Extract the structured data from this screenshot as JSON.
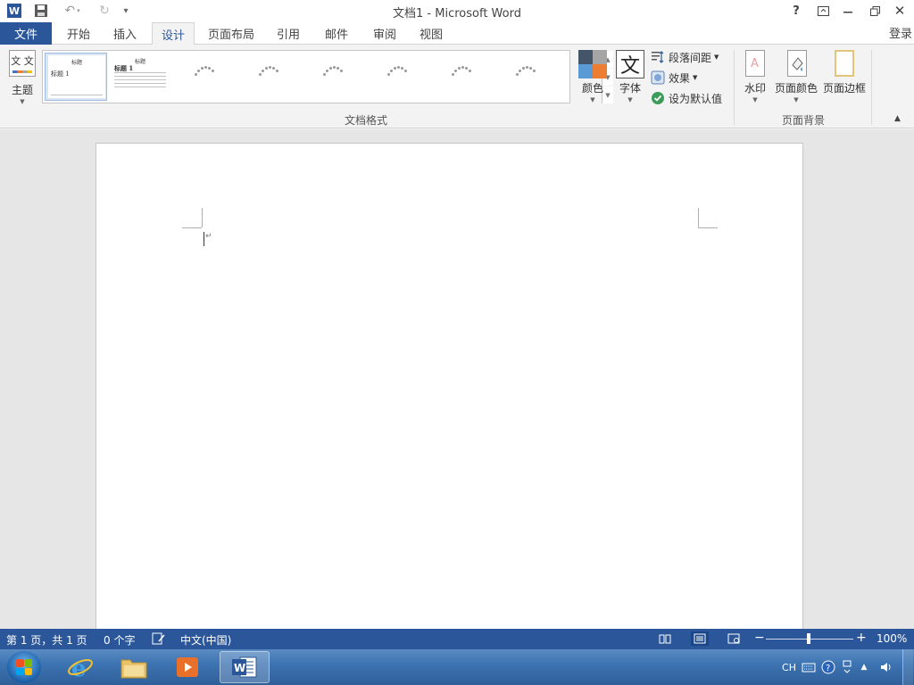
{
  "app": {
    "title": "文档1 - Microsoft Word",
    "logo_letter": "W"
  },
  "window_controls": {
    "help": "?",
    "ribbon_display": "⊡",
    "minimize": "—",
    "restore": "❐",
    "close": "✕"
  },
  "tabs": {
    "file": "文件",
    "items": [
      {
        "label": "开始"
      },
      {
        "label": "插入"
      },
      {
        "label": "设计"
      },
      {
        "label": "页面布局"
      },
      {
        "label": "引用"
      },
      {
        "label": "邮件"
      },
      {
        "label": "审阅"
      },
      {
        "label": "视图"
      }
    ],
    "active": "设计",
    "login": "登录"
  },
  "ribbon": {
    "theme_label": "主题",
    "theme_icon_text": "文 文",
    "style_set": {
      "item1_title": "标题",
      "item1_heading": "标题 1",
      "item2_title": "标题",
      "item2_heading": "标题 1"
    },
    "colors_label": "颜色",
    "fonts_label": "字体",
    "fonts_icon_text": "文",
    "paragraph_spacing_label": "段落间距",
    "effects_label": "效果",
    "set_default_label": "设为默认值",
    "group_document_formatting": "文档格式",
    "watermark_label": "水印",
    "page_color_label": "页面颜色",
    "page_borders_label": "页面边框",
    "group_page_background": "页面背景",
    "colors": {
      "swatch_dark": "#44546a",
      "swatch_gray": "#a5a5a5",
      "swatch_blue": "#5b9bd5",
      "swatch_orange": "#ed7d31",
      "accent": "#2b579a"
    }
  },
  "document": {
    "paragraph_mark": "↵"
  },
  "status": {
    "page": "第 1 页，共 1 页",
    "words": "0 个字",
    "language": "中文(中国)",
    "zoom": "100%",
    "zoom_minus": "−",
    "zoom_plus": "+",
    "zoom_level": 1.0
  },
  "taskbar": {
    "apps": [
      "internet-explorer",
      "file-explorer",
      "media-player",
      "microsoft-word"
    ],
    "active_app": "microsoft-word",
    "tray_language": "CH"
  }
}
